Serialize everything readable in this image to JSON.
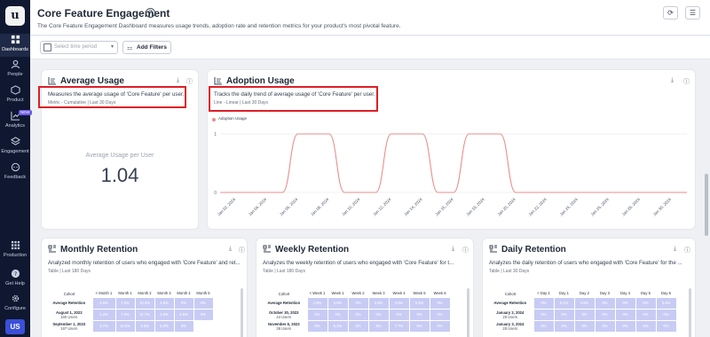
{
  "sidebar": {
    "logo": "u",
    "items": [
      {
        "label": "Dashboards",
        "icon": "dashboard-icon"
      },
      {
        "label": "People",
        "icon": "people-icon"
      },
      {
        "label": "Product",
        "icon": "product-icon"
      },
      {
        "label": "Analytics",
        "icon": "analytics-icon",
        "badge": "NEW"
      },
      {
        "label": "Engagement",
        "icon": "engagement-icon"
      },
      {
        "label": "Feedback",
        "icon": "feedback-icon"
      },
      {
        "label": "Production",
        "icon": "grid-icon"
      },
      {
        "label": "Get Help",
        "icon": "help-icon"
      },
      {
        "label": "Configure",
        "icon": "gear-icon"
      }
    ],
    "user_initials": "US"
  },
  "header": {
    "title": "Core Feature Engagement",
    "help_glyph": "?",
    "description": "The Core Feature Engagement Dashboard measures usage trends, adoption rate and retention metrics for your product's most pivotal feature.",
    "refresh_glyph": "⟳",
    "menu_glyph": "☰"
  },
  "filters": {
    "time_placeholder": "Select time period",
    "add_filters_label": "Add Filters",
    "add_filters_glyph": "⚏"
  },
  "cards": {
    "average_usage": {
      "title": "Average Usage",
      "description": "Measures the average usage of 'Core Feature' per user.",
      "meta": "Metric - Cumulative | Last 30 Days",
      "metric_label": "Average Usage per User",
      "metric_value": "1.04"
    },
    "adoption_usage": {
      "title": "Adoption Usage",
      "description": "Tracks the daily trend of average usage of 'Core Feature' per user.",
      "meta": "Line - Linear | Last 30 Days",
      "legend": "Adoption Usage"
    },
    "monthly_retention": {
      "title": "Monthly Retention",
      "description": "Analyzed monthly retention of users who engaged with 'Core Feature' and ret...",
      "meta": "Table | Last 180 Days",
      "columns": [
        "Cohort",
        "< Month 1",
        "Month 1",
        "Month 2",
        "Month 3",
        "Month 4",
        "Month 5"
      ],
      "rows": [
        {
          "label": "Average Retention",
          "sub": "",
          "values": [
            "4.5%",
            "7.5%",
            "10.3%",
            "4.5%",
            "0%",
            "0%"
          ]
        },
        {
          "label": "August 1, 2023",
          "sub": "180 Users",
          "values": [
            "4.4%",
            "7.8%",
            "12.7%",
            "3.9%",
            "4.5%",
            "0%"
          ]
        },
        {
          "label": "September 1, 2023",
          "sub": "197 Users",
          "values": [
            "3.7%",
            "10.5%",
            "4.5%",
            "5.0%",
            "0%",
            ""
          ]
        }
      ]
    },
    "weekly_retention": {
      "title": "Weekly Retention",
      "description": "Analyzes the weekly retention of users who engaged with 'Core Feature' for t...",
      "meta": "Table | Last 180 Days",
      "columns": [
        "Cohort",
        "< Week 1",
        "Week 1",
        "Week 2",
        "Week 3",
        "Week 4",
        "Week 5",
        "Week 6"
      ],
      "rows": [
        {
          "label": "Average Retention",
          "sub": "",
          "values": [
            "1.9%",
            "4.9%",
            "0%",
            "3.9%",
            "3.6%",
            "0.2%",
            "0%"
          ]
        },
        {
          "label": "October 30, 2023",
          "sub": "44 Users",
          "values": [
            "0%",
            "0%",
            "0%",
            "0%",
            "0%",
            "0%",
            "0%"
          ]
        },
        {
          "label": "November 6, 2023",
          "sub": "39 Users",
          "values": [
            "0%",
            "5.3%",
            "0%",
            "5%",
            "7.7%",
            "0%",
            "0%"
          ]
        }
      ]
    },
    "daily_retention": {
      "title": "Daily Retention",
      "description": "Analyzes the daily retention of users who engaged with 'Core Feature' for the ...",
      "meta": "Table | Last 30 Days",
      "columns": [
        "Cohort",
        "< Day 1",
        "Day 1",
        "Day 2",
        "Day 3",
        "Day 4",
        "Day 5",
        "Day 6"
      ],
      "rows": [
        {
          "label": "Average Retention",
          "sub": "",
          "values": [
            "0%",
            "0.1%",
            "4.5%",
            "0%",
            "0%",
            "0%",
            "3.4%"
          ]
        },
        {
          "label": "January 2, 2024",
          "sub": "29 Users",
          "values": [
            "0%",
            "0%",
            "0%",
            "0%",
            "0%",
            "0%",
            "0%"
          ]
        },
        {
          "label": "January 3, 2024",
          "sub": "28 Users",
          "values": [
            "0%",
            "0%",
            "0%",
            "0%",
            "0%",
            "0%",
            "0%"
          ]
        }
      ]
    }
  },
  "chart_data": {
    "type": "line",
    "title": "",
    "xlabel": "",
    "ylabel": "",
    "x": [
      "Jan 01, 2024",
      "Jan 02, 2024",
      "Jan 03, 2024",
      "Jan 04, 2024",
      "Jan 05, 2024",
      "Jan 06, 2024",
      "Jan 07, 2024",
      "Jan 08, 2024",
      "Jan 09, 2024",
      "Jan 10, 2024",
      "Jan 11, 2024",
      "Jan 12, 2024",
      "Jan 13, 2024",
      "Jan 14, 2024",
      "Jan 15, 2024",
      "Jan 16, 2024",
      "Jan 17, 2024",
      "Jan 18, 2024",
      "Jan 19, 2024",
      "Jan 20, 2024",
      "Jan 21, 2024",
      "Jan 22, 2024",
      "Jan 23, 2024",
      "Jan 24, 2024",
      "Jan 25, 2024",
      "Jan 26, 2024",
      "Jan 27, 2024",
      "Jan 28, 2024",
      "Jan 29, 2024",
      "Jan 30, 2024",
      "Jan 31, 2024"
    ],
    "x_tick_labels": [
      "Jan 02, 2024",
      "Jan 04, 2024",
      "Jan 06, 2024",
      "Jan 08, 2024",
      "Jan 10, 2024",
      "Jan 12, 2024",
      "Jan 14, 2024",
      "Jan 16, 2024",
      "Jan 18, 2024",
      "Jan 20, 2024",
      "Jan 22, 2024",
      "Jan 24, 2024",
      "Jan 26, 2024",
      "Jan 28, 2024",
      "Jan 30, 2024"
    ],
    "series": [
      {
        "name": "Adoption Usage",
        "color": "#e88e8e",
        "values": [
          0,
          0,
          0,
          0,
          0,
          1,
          1,
          1,
          0,
          0,
          0,
          1,
          1,
          1,
          0,
          0,
          1,
          1,
          1,
          0,
          0,
          0,
          0,
          0,
          0,
          0,
          0,
          0,
          0,
          0,
          0
        ]
      }
    ],
    "ylim": [
      0,
      1
    ],
    "y_ticks": [
      0,
      1
    ],
    "grid": true
  }
}
